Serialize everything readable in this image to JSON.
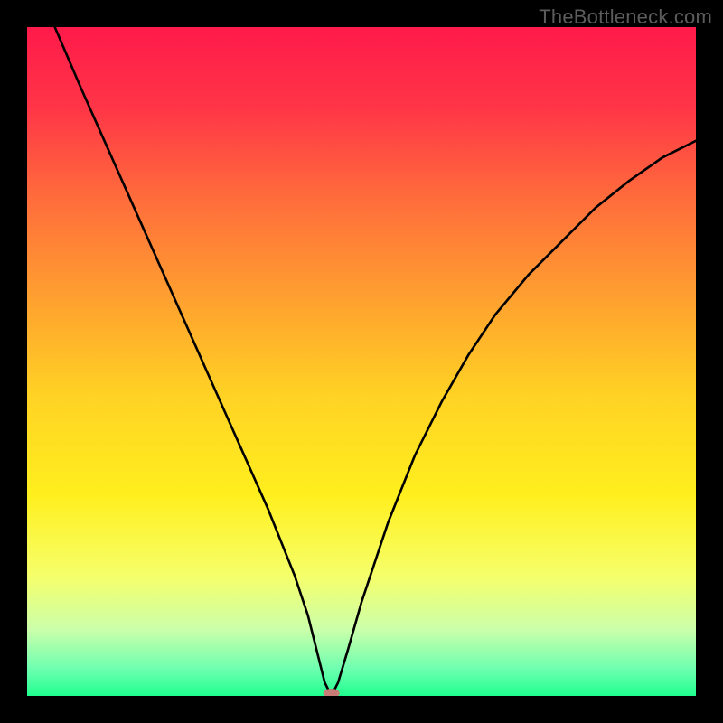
{
  "watermark": "TheBottleneck.com",
  "chart_data": {
    "type": "line",
    "title": "",
    "xlabel": "",
    "ylabel": "",
    "xlim": [
      0,
      100
    ],
    "ylim": [
      0,
      100
    ],
    "background_gradient": {
      "stops": [
        {
          "offset": 0.0,
          "color": "#ff1a4a"
        },
        {
          "offset": 0.12,
          "color": "#ff3547"
        },
        {
          "offset": 0.25,
          "color": "#ff6a3c"
        },
        {
          "offset": 0.4,
          "color": "#ff9e30"
        },
        {
          "offset": 0.55,
          "color": "#ffd224"
        },
        {
          "offset": 0.7,
          "color": "#ffef1e"
        },
        {
          "offset": 0.82,
          "color": "#f6ff6a"
        },
        {
          "offset": 0.9,
          "color": "#ccffaa"
        },
        {
          "offset": 0.96,
          "color": "#6dffb0"
        },
        {
          "offset": 1.0,
          "color": "#1fff8e"
        }
      ]
    },
    "series": [
      {
        "name": "bottleneck-curve",
        "x": [
          0,
          2,
          5,
          8,
          12,
          16,
          20,
          24,
          28,
          32,
          36,
          40,
          42,
          43.5,
          44.5,
          45.5,
          46.5,
          48,
          50,
          54,
          58,
          62,
          66,
          70,
          75,
          80,
          85,
          90,
          95,
          100
        ],
        "y": [
          110,
          105,
          98,
          91,
          82,
          73,
          64,
          55,
          46,
          37,
          28,
          18,
          12,
          6,
          2,
          0,
          2,
          7,
          14,
          26,
          36,
          44,
          51,
          57,
          63,
          68,
          73,
          77,
          80.5,
          83
        ]
      }
    ],
    "marker": {
      "x": 45.5,
      "y": 0,
      "rx": 9,
      "ry": 5,
      "fill": "#c77c78"
    }
  }
}
